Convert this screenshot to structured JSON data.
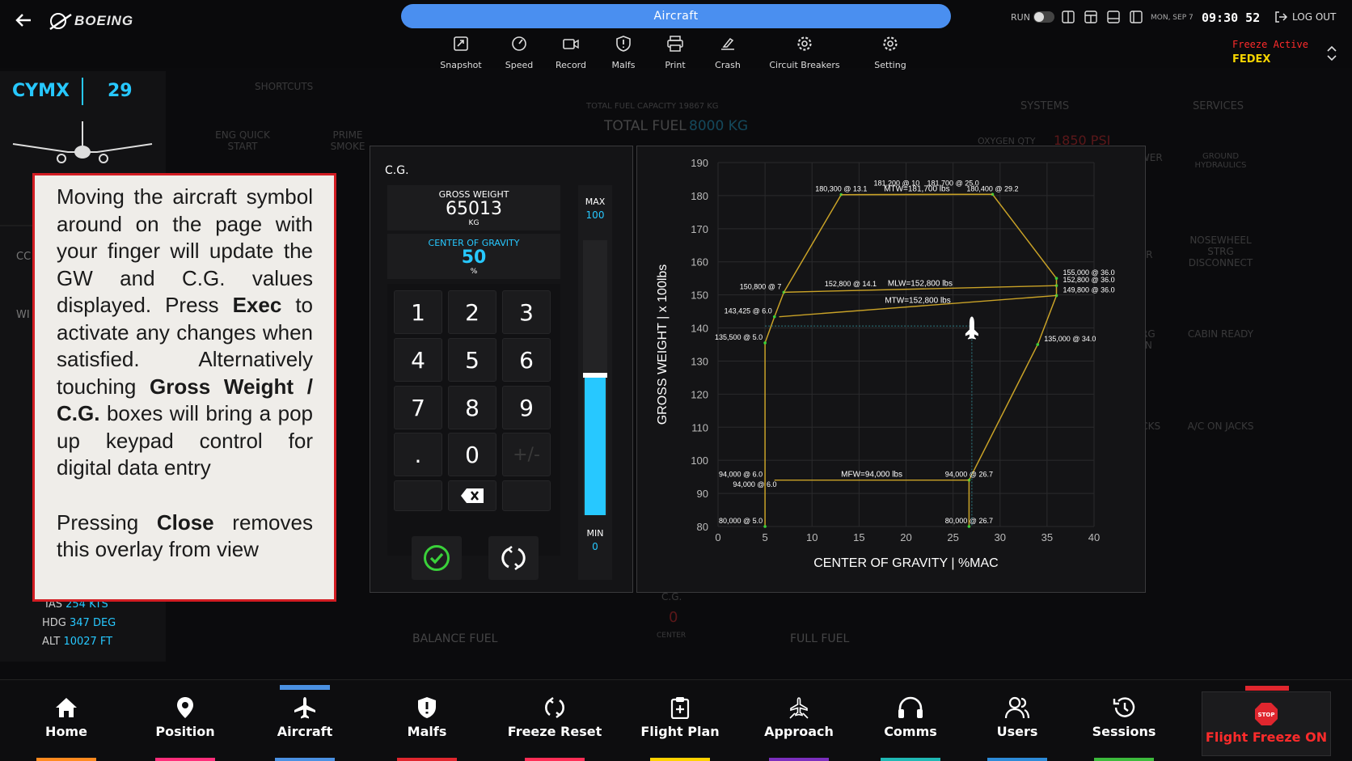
{
  "app": {
    "brand": "BOEING",
    "active_tab": "Aircraft"
  },
  "status": {
    "run_label": "RUN",
    "date": "MON, SEP 7",
    "time": "09:30 52",
    "logout": "LOG OUT",
    "freeze_active": "Freeze Active",
    "airline": "FEDEX"
  },
  "toolbar": [
    {
      "label": "Snapshot",
      "icon": "snapshot-icon"
    },
    {
      "label": "Speed",
      "icon": "speed-icon"
    },
    {
      "label": "Record",
      "icon": "record-icon"
    },
    {
      "label": "Malfs",
      "icon": "malfs-icon"
    },
    {
      "label": "Print",
      "icon": "print-icon"
    },
    {
      "label": "Crash",
      "icon": "crash-icon"
    },
    {
      "label": "Circuit Breakers",
      "icon": "gear-icon"
    },
    {
      "label": "Setting",
      "icon": "gear-icon"
    }
  ],
  "left_panel": {
    "airport": "CYMX",
    "runway": "29",
    "ias_label": "IAS",
    "ias": "254 KTS",
    "hdg_label": "HDG",
    "hdg": "347 DEG",
    "alt_label": "ALT",
    "alt": "10027 FT",
    "cc": "CC",
    "wi": "WI"
  },
  "background": {
    "shortcuts": "SHORTCUTS",
    "eng_quick_start": "ENG QUICK START",
    "prime_smoke": "PRIME SMOKE",
    "total_fuel_capacity": "TOTAL FUEL CAPACITY 19867 KG",
    "total_fuel_label": "TOTAL FUEL",
    "total_fuel_value": "8000 KG",
    "systems": "SYSTEMS",
    "services": "SERVICES",
    "oxygen_qty": "OXYGEN QTY",
    "oxygen_value": "1850 PSI",
    "balance_fuel": "BALANCE FUEL",
    "full_fuel": "FULL FUEL",
    "cg_label": "C.G.",
    "cg_value": "0",
    "center": "CENTER",
    "services_buttons": [
      "GROUND POWER",
      "GROUND HYDRAULICS",
      "GROUND AIR",
      "NOSEWHEEL STRG DISCONNECT",
      "CABIN EMERG EVACUATION",
      "CABIN READY",
      "WHEEL CHOCKS",
      "A/C ON JACKS"
    ]
  },
  "cg_panel": {
    "title": "C.G.",
    "gross_weight_label": "GROSS WEIGHT",
    "gross_weight_value": "65013",
    "gross_weight_unit": "KG",
    "cg_label": "CENTER OF GRAVITY",
    "cg_value": "50",
    "cg_unit": "%",
    "max_label": "MAX",
    "max_value": "100",
    "min_label": "MIN",
    "min_value": "0",
    "slider_fraction": 0.5,
    "keys": [
      "1",
      "2",
      "3",
      "4",
      "5",
      "6",
      "7",
      "8",
      "9",
      ".",
      "0",
      "+/-"
    ]
  },
  "chart_data": {
    "type": "line",
    "xlabel": "CENTER OF GRAVITY | %MAC",
    "ylabel": "GROSS WEIGHT | x 100lbs",
    "xlim": [
      0,
      40
    ],
    "ylim": [
      80,
      190
    ],
    "xticks": [
      0,
      5,
      10,
      15,
      20,
      25,
      30,
      35,
      40
    ],
    "yticks": [
      80,
      90,
      100,
      110,
      120,
      130,
      140,
      150,
      160,
      170,
      180,
      190
    ],
    "grid": true,
    "envelope": [
      [
        5.0,
        80.0
      ],
      [
        5.0,
        135.5
      ],
      [
        6.0,
        143.4
      ],
      [
        7.0,
        150.8
      ],
      [
        13.1,
        180.3
      ],
      [
        29.2,
        180.4
      ],
      [
        36.0,
        155.0
      ],
      [
        36.0,
        152.8
      ],
      [
        36.0,
        149.8
      ],
      [
        34.0,
        135.0
      ],
      [
        26.7,
        94.0
      ],
      [
        26.7,
        80.0
      ]
    ],
    "lines": [
      {
        "label": "MTW=181,700 lbs",
        "points": [
          [
            13.1,
            180.3
          ],
          [
            29.2,
            180.4
          ]
        ]
      },
      {
        "label": "MLW=152,800 lbs",
        "points": [
          [
            7.0,
            150.8
          ],
          [
            36.0,
            152.8
          ]
        ]
      },
      {
        "label": "MTW=152,800 lbs",
        "points": [
          [
            6.5,
            143.4
          ],
          [
            36.0,
            149.8
          ]
        ]
      },
      {
        "label": "MFW=94,000 lbs",
        "points": [
          [
            6.0,
            94.0
          ],
          [
            26.7,
            94.0
          ]
        ]
      }
    ],
    "point_labels": [
      {
        "text": "181,200 @ 10",
        "x": 19,
        "y": 182
      },
      {
        "text": "181,700 @ 25.0",
        "x": 25,
        "y": 182
      },
      {
        "text": "180,300 @ 13.1",
        "x": 13.1,
        "y": 180.3
      },
      {
        "text": "180,400 @ 29.2",
        "x": 29.2,
        "y": 180.4
      },
      {
        "text": "155,000 @ 36.0",
        "x": 36,
        "y": 155
      },
      {
        "text": "152,800 @ 36.0",
        "x": 36,
        "y": 152.8
      },
      {
        "text": "150,800 @ 7",
        "x": 7,
        "y": 150.8
      },
      {
        "text": "152,800 @ 14.1",
        "x": 14.1,
        "y": 151.6
      },
      {
        "text": "149,800 @ 36.0",
        "x": 36,
        "y": 149.8
      },
      {
        "text": "143,425 @ 6.0",
        "x": 6,
        "y": 143.4
      },
      {
        "text": "135,500 @ 5.0",
        "x": 5,
        "y": 135.5
      },
      {
        "text": "135,000 @ 34.0",
        "x": 34,
        "y": 135
      },
      {
        "text": "94,000 @ 6.0",
        "x": 5,
        "y": 94
      },
      {
        "text": "94,000 @ 6.0",
        "x": 6.5,
        "y": 91
      },
      {
        "text": "94,000 @ 26.7",
        "x": 26.7,
        "y": 94
      },
      {
        "text": "80,000 @ 5.0",
        "x": 5,
        "y": 80
      },
      {
        "text": "80,000 @ 26.7",
        "x": 26.7,
        "y": 80
      }
    ],
    "aircraft_marker": {
      "x": 27,
      "y": 140
    }
  },
  "help_overlay": {
    "p1_a": "Moving the aircraft symbol around on the page with your finger will update the GW and C.G. values displayed. Press",
    "p1_exec": "Exec",
    "p1_b": "to activate any changes when satisfied. Alternatively touching",
    "p1_gw": "Gross Weight / C.G.",
    "p1_c": "boxes will bring a pop up keypad control for digital data entry",
    "p2_a": "Pressing",
    "p2_close": "Close",
    "p2_b": "removes this overlay from view"
  },
  "bottom_nav": [
    {
      "label": "Home",
      "color": "#ff8a1f"
    },
    {
      "label": "Position",
      "color": "#ff2d7a"
    },
    {
      "label": "Aircraft",
      "color": "#4a90e2"
    },
    {
      "label": "Malfs",
      "color": "#e0262e"
    },
    {
      "label": "Freeze Reset",
      "color": "#ff2d55"
    },
    {
      "label": "Flight Plan",
      "color": "#ffd200"
    },
    {
      "label": "Approach",
      "color": "#7b2fbe"
    },
    {
      "label": "Comms",
      "color": "#1fb8b4"
    },
    {
      "label": "Users",
      "color": "#2d8bd8"
    },
    {
      "label": "Sessions",
      "color": "#3cba3c"
    },
    {
      "label": "Flight Freeze ON",
      "color": "#e0262e"
    }
  ],
  "colors": {
    "accent_blue": "#4a8ff0",
    "cyan": "#27c8ff",
    "freeze_red": "#ff2b2b",
    "freeze_yellow": "#f5d400",
    "envelope": "#c9a227"
  }
}
